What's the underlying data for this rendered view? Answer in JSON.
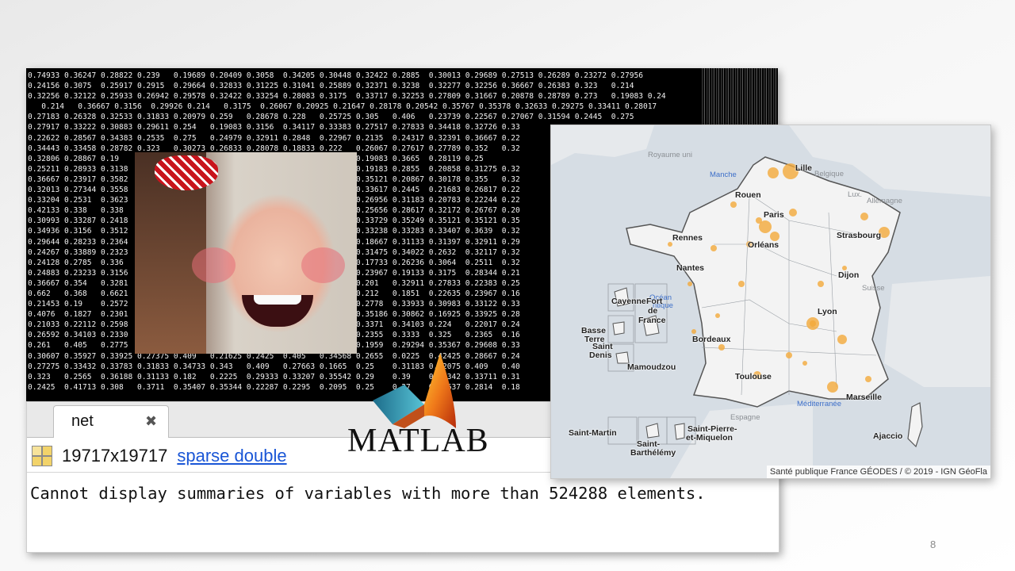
{
  "console": {
    "lines": [
      "0.74933 0.36247 0.28822 0.239   0.19689 0.20409 0.3058  0.34205 0.30448 0.32422 0.2885  0.30013 0.29689 0.27513 0.26289 0.23272 0.27956",
      "0.24156 0.3075  0.25917 0.2915  0.29664 0.32833 0.31225 0.31041 0.25889 0.32371 0.3238  0.32277 0.32256 0.36667 0.26383 0.323   0.214",
      "0.32256 0.32122 0.25933 0.26942 0.29578 0.32422 0.33254 0.28083 0.3175  0.33717 0.32253 0.27809 0.31667 0.20878 0.28789 0.273   0.19083 0.24",
      "   0.214   0.36667 0.3156  0.29926 0.214   0.3175  0.26067 0.20925 0.21647 0.28178 0.20542 0.35767 0.35378 0.32633 0.29275 0.33411 0.28017",
      "0.27183 0.26328 0.32533 0.31833 0.20979 0.259   0.28678 0.228   0.25725 0.305   0.406   0.23739 0.22567 0.27067 0.31594 0.2445  0.275",
      "0.27917 0.33222 0.30883 0.29611 0.254   0.19083 0.3156  0.34117 0.33383 0.27517 0.27833 0.34418 0.32726 0.33",
      "0.22622 0.28567 0.34383 0.2535  0.275   0.24979 0.32911 0.2848  0.22967 0.2135  0.24317 0.32391 0.36667 0.22",
      "0.34443 0.33458 0.28782 0.323   0.30273 0.26833 0.28078 0.18833 0.222   0.26067 0.27617 0.27789 0.352   0.32",
      "0.32806 0.28867 0.19    0.21    0.26    0.24    0.29    0.31    0.33689 0.19083 0.3665  0.28119 0.25",
      "0.25211 0.28933 0.3138  0.27    0.23    0.30    0.28    0.29    0.3767  0.19183 0.2855  0.20858 0.31275 0.32",
      "0.36667 0.23917 0.3582  0.26    0.24    0.27    0.31    0.22    0.3767  0.35121 0.20867 0.30178 0.355   0.32",
      "0.32013 0.27344 0.3558  0.29    0.25    0.26    0.30    0.24    0.3074  0.33617 0.2445  0.21683 0.26817 0.22",
      "0.33204 0.2531  0.3623  0.23    0.27    0.28    0.26    0.31    0.3856  0.26956 0.31183 0.20783 0.22244 0.22",
      "0.42133 0.338   0.338   0.27    0.21    0.30    0.25    0.28    0.2167  0.25656 0.28617 0.32172 0.26767 0.20",
      "0.30993 0.33287 0.2418  0.25    0.28    0.24    0.27    0.29    0.3242  0.33729 0.35249 0.35121 0.35121 0.35",
      "0.34936 0.3156  0.3512  0.28    0.23    0.26    0.29    0.31    0.2886  0.33238 0.33283 0.33407 0.3639  0.32",
      "0.29644 0.28233 0.2364  0.30    0.26    0.25    0.28    0.22    0.3985  0.18667 0.31133 0.31397 0.32911 0.29",
      "0.24267 0.33889 0.2323  0.24    0.29    0.27    0.30    0.26    0.3956  0.31475 0.34022 0.2632  0.32117 0.32",
      "0.24128 0.2785  0.336   0.27    0.25    0.31    0.24    0.28    0.3878  0.17733 0.26236 0.3064  0.2511  0.32",
      "0.24883 0.23233 0.3156  0.26    0.28    0.23    0.27    0.30    0.2133  0.23967 0.19133 0.3175  0.28344 0.21",
      "0.36667 0.354   0.3281  0.29    0.24    0.26    0.28    0.25    0.2967  0.201   0.32911 0.27833 0.22383 0.25",
      "0.662   0.368   0.6621  0.25    0.27    0.30    0.23    0.29    0.2972  0.212   0.1851  0.22635 0.23967 0.16",
      "0.21453 0.19    0.2572  0.28    0.26    0.24    0.31    0.27    0.3775  0.2778  0.33933 0.30983 0.33122 0.33",
      "0.4076  0.1827  0.2301  0.23    0.29    0.27    0.25    0.28    0.4657  0.35186 0.30862 0.16925 0.33925 0.28",
      "0.21033 0.22112 0.2598  0.27    0.24    0.29    0.26    0.30    0.2613  0.3371  0.34103 0.224   0.22017 0.24",
      "0.26592 0.34103 0.2330  0.26    0.28    0.25    0.30    0.24    0.2825  0.2355  0.3333  0.325   0.2365  0.16",
      "0.261   0.405   0.2775  0.30    0.23    0.28    0.27    0.26    0.2245  0.1959  0.29294 0.35367 0.29608 0.33",
      "0.30607 0.35927 0.33925 0.27375 0.409   0.21625 0.2425  0.405   0.34568 0.2655  0.0225  0.42425 0.28667 0.24",
      "0.27275 0.33432 0.33783 0.31833 0.34733 0.343   0.409   0.27663 0.1665  0.25    0.31183 0.22075 0.409   0.40",
      "0.323   0.2565  0.36188 0.31133 0.182   0.2225  0.29333 0.33207 0.35542 0.29    0.39    0.28342 0.33711 0.31",
      "0.2425  0.41713 0.308   0.3711  0.35407 0.35344 0.22287 0.2295  0.2095  0.25    0.27    0.34637 0.2814  0.18"
    ]
  },
  "workspace": {
    "tab_label": "net",
    "tab_close": "✖",
    "size_text": "19717x19717",
    "type_link": "sparse double",
    "message": "Cannot display summaries of variables with more than 524288 elements."
  },
  "logo": {
    "word": "MATLAB",
    "icon": "matlab-membrane-icon"
  },
  "photo": {
    "icon": "meme-face-photo"
  },
  "map": {
    "credit": "Santé publique France GÉODES / © 2019 - IGN GéoFla",
    "countries": {
      "uk": "Royaume uni",
      "belgium": "Belgique",
      "lux": "Lux.",
      "germany": "Allemagne",
      "suisse": "Suisse",
      "espagne": "Espagne"
    },
    "seas": {
      "manche": "Manche",
      "ocean_1": "Océan",
      "ocean_2": "ntique",
      "med": "Méditerranée"
    },
    "cities": {
      "lille": "Lille",
      "rouen": "Rouen",
      "paris": "Paris",
      "rennes": "Rennes",
      "orleans": "Orléans",
      "strasbourg": "Strasbourg",
      "nantes": "Nantes",
      "dijon": "Dijon",
      "lyon": "Lyon",
      "bordeaux": "Bordeaux",
      "toulouse": "Toulouse",
      "marseille": "Marseille",
      "ajaccio": "Ajaccio"
    },
    "overseas": {
      "cayenne": "Cayenne",
      "fort": "Fort",
      "de": "de",
      "france": "France",
      "basse": "Basse",
      "terre": "Terre",
      "saint": "Saint",
      "denis": "Denis",
      "mamoudzou": "Mamoudzou",
      "saint_martin": "Saint-Martin",
      "saint_barth_1": "Saint-",
      "saint_barth_2": "Barthélémy",
      "saint_pierre_1": "Saint-Pierre-",
      "saint_pierre_2": "et-Miquelon"
    },
    "colors": {
      "land": "#f3f3f3",
      "sea": "#d6dde4",
      "bubble": "#f3a93a"
    }
  },
  "slide": {
    "page_number": "8"
  }
}
